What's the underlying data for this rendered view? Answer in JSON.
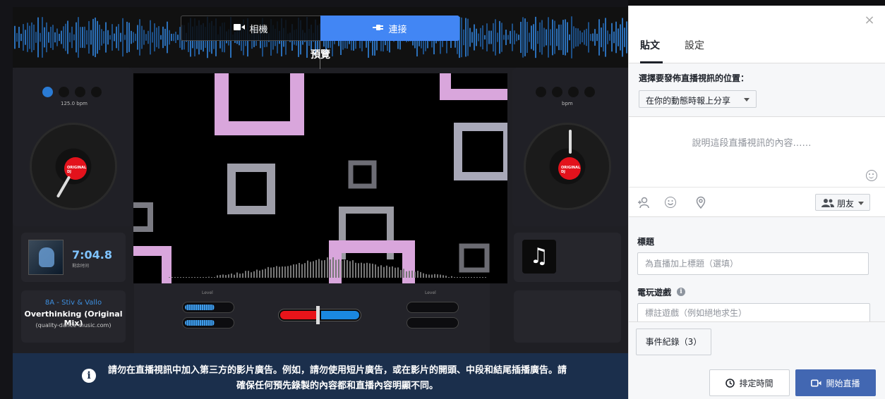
{
  "source_toggle": {
    "camera_label": "相機",
    "connect_label": "連接"
  },
  "preview": {
    "label": "預覽",
    "dj": {
      "left_bpm": "125.0 bpm",
      "right_bpm": "bpm",
      "record_label": "ORIGINAL DJ",
      "time": "7:04.8",
      "time_sub": "剩余时间",
      "track_artist": "8A - Stiv & Vallo",
      "track_title": "Overthinking (Original Mix)",
      "track_site": "(quality-dance-music.com)",
      "level_label": "Level",
      "meter_levels": [
        0.62,
        0.62,
        0,
        0
      ]
    }
  },
  "warning": {
    "icon": "info-icon",
    "text": "請勿在直播視訊中加入第三方的影片廣告。例如，請勿使用短片廣告，或在影片的開頭、中段和結尾插播廣告。請確保任何預先錄製的內容都和直播內容明顯不同。"
  },
  "sidebar": {
    "close": "×",
    "tabs": [
      {
        "label": "貼文",
        "active": true
      },
      {
        "label": "設定",
        "active": false
      }
    ],
    "where_label": "選擇要發佈直播視訊的位置：",
    "where_value": "在你的動態時報上分享",
    "description_placeholder": "說明這段直播視訊的內容……",
    "audience_label": "朋友",
    "title_label": "標題",
    "title_placeholder": "為直播加上標題（選填）",
    "game_label": "電玩遊戲",
    "game_placeholder": "標註遊戲（例如絕地求生）",
    "event_log_label": "事件紀錄（3）",
    "schedule_label": "排定時間",
    "go_live_label": "開始直播"
  },
  "colors": {
    "accent": "#4286f4",
    "go_live": "#4267b2",
    "banner": "#1b2f4c"
  }
}
